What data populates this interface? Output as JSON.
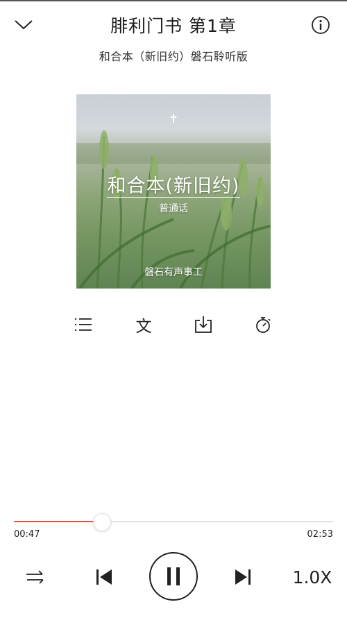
{
  "header": {
    "title": "腓利门书 第1章",
    "subtitle": "和合本（新旧约）磐石聆听版"
  },
  "cover": {
    "cross": "✝",
    "title": "和合本(新旧约)",
    "language": "普通话",
    "publisher": "磐石有声事工"
  },
  "tools": {
    "text_glyph": "文"
  },
  "player": {
    "current_time": "00:47",
    "total_time": "02:53",
    "progress": 0.277,
    "speed": "1.0X"
  },
  "colors": {
    "accent": "#e2534b",
    "text": "#1a1a1a",
    "track": "#e3e3e3"
  },
  "icons": [
    "chevron-down-icon",
    "info-icon",
    "playlist-icon",
    "text-icon",
    "download-icon",
    "timer-icon",
    "repeat-mode-icon",
    "previous-icon",
    "pause-icon",
    "next-icon"
  ]
}
